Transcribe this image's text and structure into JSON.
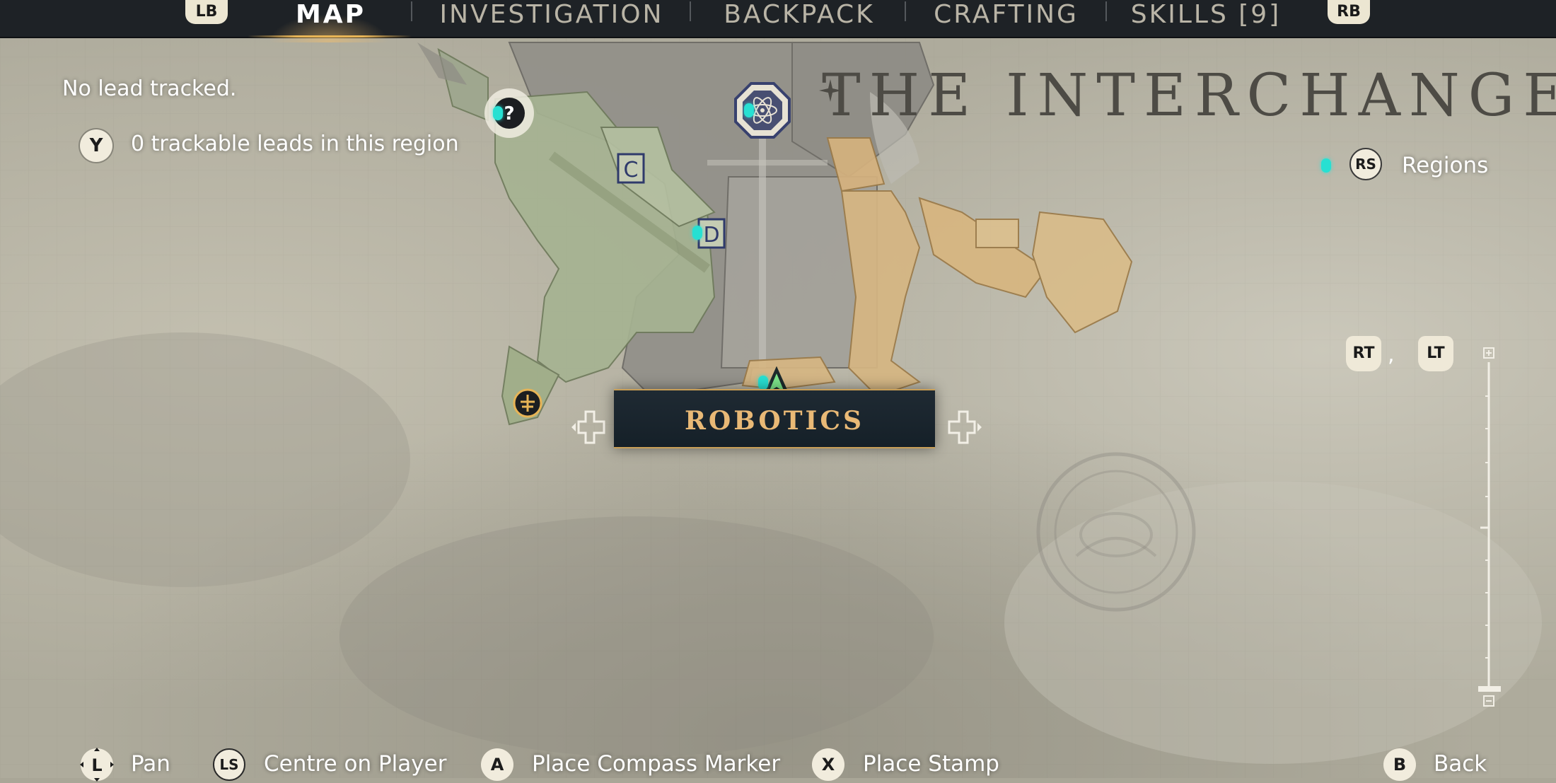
{
  "nav": {
    "left_bumper": "LB",
    "right_bumper": "RB",
    "tabs": [
      {
        "label": "MAP",
        "active": true
      },
      {
        "label": "INVESTIGATION",
        "active": false
      },
      {
        "label": "BACKPACK",
        "active": false
      },
      {
        "label": "CRAFTING",
        "active": false
      },
      {
        "label": "SKILLS [9]",
        "active": false
      }
    ]
  },
  "lead": {
    "status": "No lead tracked.",
    "button": "Y",
    "trackable_text": "0 trackable leads in this region"
  },
  "region_title": "THE INTERCHANGE",
  "regions": {
    "button": "RS",
    "label": "Regions"
  },
  "zoom": {
    "zoom_in_button": "RT",
    "separator": ",",
    "zoom_out_button": "LT",
    "level": 0
  },
  "map": {
    "selected_area": "ROBOTICS",
    "markers": [
      {
        "icon": "question-marker-icon",
        "label": "?"
      },
      {
        "icon": "atom-marker-icon"
      },
      {
        "icon": "letter-marker-icon",
        "label": "C"
      },
      {
        "icon": "letter-marker-icon",
        "label": "D"
      },
      {
        "icon": "player-arrow-icon"
      },
      {
        "icon": "fast-travel-icon"
      }
    ]
  },
  "footer": [
    {
      "button": "L",
      "label": "Pan"
    },
    {
      "button": "LS",
      "label": "Centre on Player"
    },
    {
      "button": "A",
      "label": "Place Compass Marker"
    },
    {
      "button": "X",
      "label": "Place Stamp"
    },
    {
      "button": "B",
      "label": "Back"
    }
  ],
  "colors": {
    "nav_bg": "#1e2226",
    "accent_gold": "#e7b456",
    "banner_text": "#e9b976",
    "paper": "#a9a697",
    "map_green": "#9fae88",
    "map_orange": "#d8b680",
    "map_grey": "#8f8c84",
    "teal_marker": "#27e0d2"
  }
}
